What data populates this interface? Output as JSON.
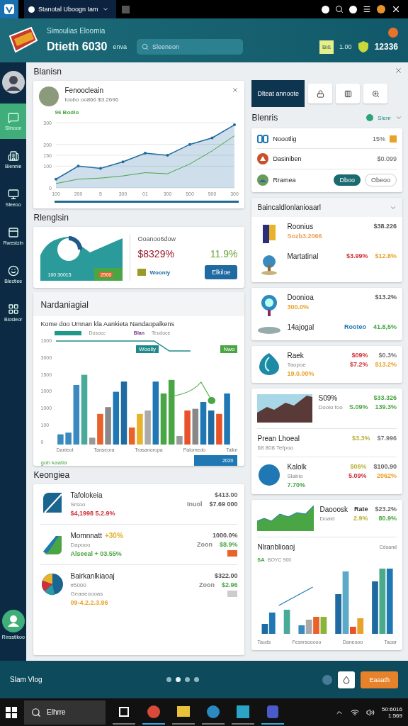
{
  "browser": {
    "tab_title": "Stanotal Uboogn Iam"
  },
  "header": {
    "subtitle": "Simoulias Eloomia",
    "title": "Dtieth 6030",
    "title_suffix": "enva",
    "search": {
      "placeholder": "Sleeneon"
    },
    "badge": "Biß",
    "count": "1.00",
    "score": "12336"
  },
  "sidebar": {
    "items": [
      {
        "label": "Slinoon",
        "selected": true
      },
      {
        "label": "Blennie",
        "selected": false
      },
      {
        "label": "Sleeoo",
        "selected": false
      },
      {
        "label": "Rwestzin",
        "selected": false
      },
      {
        "label": "Blectiee",
        "selected": false
      },
      {
        "label": "Blosleor",
        "selected": false
      }
    ],
    "footer_label": "Rinsstikoo"
  },
  "overview": {
    "title": "Blanisn",
    "person": {
      "name": "Fenoocleain",
      "detail": "toobo oo866 $3.2696"
    },
    "chart_data": {
      "type": "area",
      "grid": true,
      "categories": [
        "100",
        "200",
        "5",
        "300",
        "01",
        "300",
        "500",
        "500",
        "300"
      ],
      "ylim": [
        0,
        300
      ],
      "yticks": [
        0,
        100,
        150,
        200,
        300
      ],
      "series": [
        {
          "name": "96 Bodio",
          "color": "#1f6aa0",
          "values": [
            40,
            100,
            90,
            120,
            160,
            150,
            200,
            230,
            290
          ]
        },
        {
          "type": "line",
          "color": "#4aa544",
          "values": [
            20,
            40,
            45,
            55,
            70,
            65,
            110,
            170,
            240
          ]
        }
      ]
    }
  },
  "summary": {
    "title": "Rlenglsin",
    "legend": "100 30015",
    "tag": "2500",
    "heading": "Ooanoo6dow",
    "value": "$8329%",
    "change": "11.9%",
    "swatch_label": "Woonly",
    "button": "Elkiloe"
  },
  "analysis": {
    "title": "Nardaniagial",
    "chart_title": "Kome doo Umnan kla Aankieta Nandaopalkens",
    "legend": [
      "Dosocc",
      "Blan",
      "Teudoce"
    ],
    "flags": [
      "Woolly",
      "Nwo"
    ],
    "y_ticks": [
      "1000",
      "3000",
      "1500",
      "1000",
      "1000",
      "100",
      "0"
    ],
    "x_labels": [
      "Danieot",
      "Tanseora",
      "Trasanoropa",
      "Palomedo",
      "Taikn"
    ],
    "footnote": "gob kaatia",
    "chip": "2020"
  },
  "holdings": {
    "title": "Keongiea",
    "rows": [
      {
        "kind": "slash",
        "title": "Tafolokeia",
        "notes": [
          "Srsoo"
        ],
        "detail": {
          "text": "$4,1998 5.2.9%",
          "color": "#d0303a"
        },
        "values": [
          {
            "text": "$413.00",
            "color": "#666666"
          },
          {
            "text": "Inuol",
            "color": "#888888"
          },
          {
            "text": "$7.69 000",
            "color": "#555555"
          }
        ]
      },
      {
        "kind": "leaf",
        "title": "Momnnatt",
        "title_note": {
          "text": "+30%",
          "color": "#e2b22a"
        },
        "notes": [
          "Dapooo"
        ],
        "detail": {
          "text": "Alseeal + 03.55%",
          "color": "#4aa544"
        },
        "values": [
          {
            "text": "1000.0%",
            "color": "#555555"
          },
          {
            "text": "Zoon",
            "color": "#888888"
          },
          {
            "text": "$8.9%",
            "color": "#4aa544"
          }
        ],
        "color": "#e8622a"
      },
      {
        "kind": "pie",
        "title": "Bairkanlkiaoaj",
        "notes": [
          "#5000",
          "Geaaeoooas"
        ],
        "detail": {
          "text": "09-4.2.2.3.96",
          "color": "#e8a22a"
        },
        "values": [
          {
            "text": "$322.00",
            "color": "#555555"
          },
          {
            "text": "Zoon",
            "color": "#888888"
          },
          {
            "text": "$2.96",
            "color": "#4aa544"
          }
        ],
        "color": "#cccccc"
      }
    ]
  },
  "side": {
    "tab": "Dlteat annoote",
    "title": "Blenris",
    "filter": "Slenr",
    "quick": [
      {
        "kind": "badge",
        "label": "Noootlig",
        "value": "15%"
      },
      {
        "kind": "value",
        "label": "Dasiniben",
        "value": "$0.099"
      },
      {
        "kind": "actions",
        "label": "Rramea",
        "actions": [
          "Dboo",
          "Obeoo"
        ]
      }
    ],
    "group_title": "Baincaldlonlanioaarl",
    "cards": [
      {
        "entries": [
          {
            "kind": "flag",
            "title": "Roonius",
            "detail": {
              "text": "Sozb3.2066",
              "color": "#e8a25a"
            },
            "values": [
              {
                "text": "$38.226",
                "color": "#555555"
              }
            ]
          },
          {
            "kind": "tree",
            "title": "Martatinal",
            "values": [
              {
                "text": "$3.99%",
                "color": "#d0303a"
              },
              {
                "text": "$12.8%",
                "color": "#e8a22a"
              }
            ]
          }
        ]
      },
      {
        "entries": [
          {
            "kind": "pin",
            "title": "Doonioa",
            "detail": {
              "text": "300.0%",
              "color": "#e8a22a"
            },
            "values": [
              {
                "text": "$13.2%",
                "color": "#555555"
              }
            ]
          },
          {
            "kind": "stand",
            "title": "14ajogal",
            "values": [
              {
                "text": "Rooteo",
                "color": "#1f78b4"
              },
              {
                "text": "41.8,5%",
                "color": "#4aa544"
              }
            ]
          }
        ]
      },
      {
        "entries": [
          {
            "kind": "drop",
            "title": "Raek",
            "notes": [
              "Taopoe"
            ],
            "detail": {
              "text": "19.0.00%",
              "color": "#e8a22a"
            },
            "values": [
              {
                "text": "$09%",
                "color": "#d0303a"
              },
              {
                "text": "$0.3%",
                "color": "#777777"
              },
              {
                "text": "$7.2%",
                "color": "#d0303a"
              },
              {
                "text": "$13.2%",
                "color": "#e8a22a"
              }
            ]
          }
        ]
      },
      {
        "entries": [
          {
            "kind": "mountain",
            "title": "S09%",
            "notes": [
              "Doolo foo"
            ],
            "values": [
              {
                "text": "$33.326",
                "color": "#4aa544"
              },
              {
                "text": "S.09%",
                "color": "#4aa544"
              },
              {
                "text": "139.3%",
                "color": "#4aa544"
              }
            ]
          },
          {
            "kind": "plain",
            "title": "Prean Lhoeal",
            "notes": [
              "68 808 Tefpoo"
            ],
            "values": [
              {
                "text": "$3.3%",
                "color": "#b8b23a"
              },
              {
                "text": "$7.996",
                "color": "#777777"
              }
            ]
          },
          {
            "kind": "disc",
            "title": "Kalolk",
            "notes": [
              "Slabio"
            ],
            "detail": {
              "text": "7.70%",
              "color": "#4aa544"
            },
            "values": [
              {
                "text": "$06%",
                "color": "#b8b23a"
              },
              {
                "text": "$100.90",
                "color": "#666666"
              },
              {
                "text": "5.09%",
                "color": "#d0303a"
              },
              {
                "text": "2062%",
                "color": "#e8a22a"
              }
            ]
          }
        ]
      },
      {
        "entries": [
          {
            "kind": "hills",
            "title": "Daooosk",
            "notes": [
              "Doald"
            ],
            "values": [
              {
                "text": "Rate",
                "color": "#333333"
              },
              {
                "text": "$23.2%",
                "color": "#666666"
              },
              {
                "text": "2.9%",
                "color": "#b8b23a"
              },
              {
                "text": "80.9%",
                "color": "#4aa544"
              }
            ]
          }
        ],
        "chart": {
          "title": "Nlranblioaoj",
          "legend_value": "$A",
          "legend": "BOYC 900",
          "corner": "Cdoand",
          "x_labels": [
            "Tauds",
            "Fesnrsooooo",
            "Daneooo",
            "Taoar"
          ]
        }
      }
    ]
  },
  "footer": {
    "label": "Slam Vlog",
    "pages": [
      {
        "selected": false
      },
      {
        "selected": true
      },
      {
        "selected": false
      },
      {
        "selected": false
      }
    ],
    "button": "Eaaath"
  },
  "taskbar": {
    "search": "Elhrre",
    "apps": [
      {
        "active": false
      },
      {
        "active": true
      },
      {
        "active": false
      },
      {
        "active": false
      },
      {
        "active": false
      },
      {
        "active": true
      }
    ],
    "date": "50:6016",
    "time": "1:569"
  }
}
